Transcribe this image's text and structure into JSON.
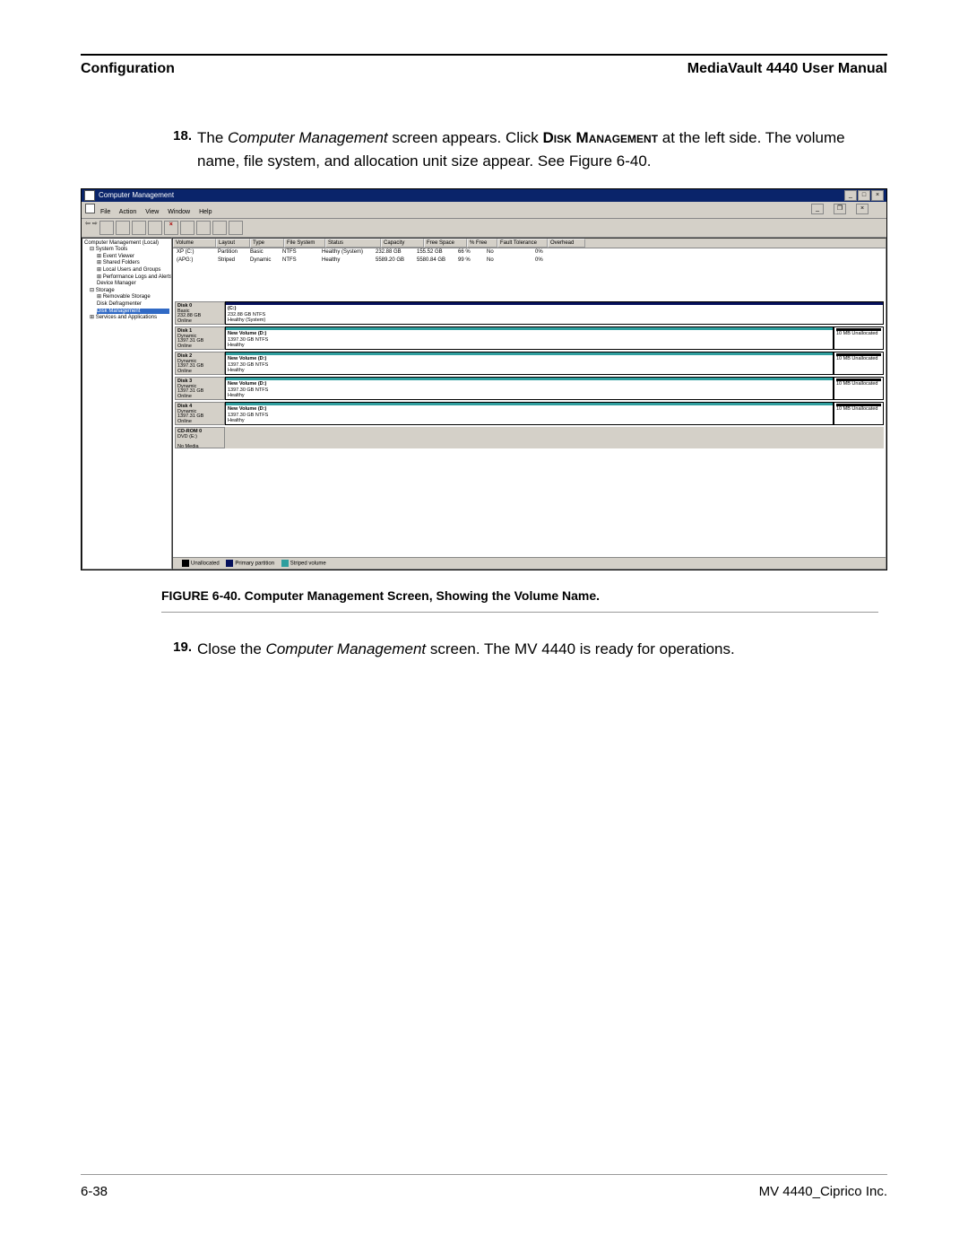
{
  "header": {
    "left": "Configuration",
    "right": "MediaVault 4440 User Manual"
  },
  "step18": {
    "num": "18.",
    "t1": "The ",
    "t2": "Computer Management",
    "t3": " screen appears. Click ",
    "t4": "Disk Management",
    "t5": " at the left side. The volume name, file system, and allocation unit size appear. See Figure 6-40."
  },
  "screenshot": {
    "title": "Computer Management",
    "menus": [
      "File",
      "Action",
      "View",
      "Window",
      "Help"
    ],
    "tree": {
      "root": "Computer Management (Local)",
      "systools": "System Tools",
      "st_items": [
        "Event Viewer",
        "Shared Folders",
        "Local Users and Groups",
        "Performance Logs and Alerts",
        "Device Manager"
      ],
      "storage": "Storage",
      "storage_items": [
        "Removable Storage",
        "Disk Defragmenter",
        "Disk Management"
      ],
      "services": "Services and Applications"
    },
    "vol_headers": [
      "Volume",
      "Layout",
      "Type",
      "File System",
      "Status",
      "Capacity",
      "Free Space",
      "% Free",
      "Fault Tolerance",
      "Overhead"
    ],
    "vol_rows": [
      {
        "v": "XP (C:)",
        "layout": "Partition",
        "type": "Basic",
        "fs": "NTFS",
        "status": "Healthy (System)",
        "cap": "232.88 GB",
        "free": "155.52 GB",
        "pct": "66 %",
        "ft": "No",
        "ov": "0%"
      },
      {
        "v": "(APG:)",
        "layout": "Striped",
        "type": "Dynamic",
        "fs": "NTFS",
        "status": "Healthy",
        "cap": "5589.20 GB",
        "free": "5580.84 GB",
        "pct": "99 %",
        "ft": "No",
        "ov": "0%"
      }
    ],
    "disks": [
      {
        "name": "Disk 0",
        "kind": "Basic",
        "size": "232.88 GB",
        "state": "Online",
        "vol": "(C:)",
        "vdesc": "232.88 GB NTFS",
        "vstat": "Healthy (System)",
        "stripe": "navy",
        "unalloc": ""
      },
      {
        "name": "Disk 1",
        "kind": "Dynamic",
        "size": "1397.31 GB",
        "state": "Online",
        "vol": "New Volume (D:)",
        "vdesc": "1397.30 GB NTFS",
        "vstat": "Healthy",
        "stripe": "teal",
        "unalloc": "10 MB Unallocated"
      },
      {
        "name": "Disk 2",
        "kind": "Dynamic",
        "size": "1397.31 GB",
        "state": "Online",
        "vol": "New Volume (D:)",
        "vdesc": "1397.30 GB NTFS",
        "vstat": "Healthy",
        "stripe": "teal",
        "unalloc": "10 MB Unallocated"
      },
      {
        "name": "Disk 3",
        "kind": "Dynamic",
        "size": "1397.31 GB",
        "state": "Online",
        "vol": "New Volume (D:)",
        "vdesc": "1397.30 GB NTFS",
        "vstat": "Healthy",
        "stripe": "teal",
        "unalloc": "10 MB Unallocated"
      },
      {
        "name": "Disk 4",
        "kind": "Dynamic",
        "size": "1397.31 GB",
        "state": "Online",
        "vol": "New Volume (D:)",
        "vdesc": "1397.30 GB NTFS",
        "vstat": "Healthy",
        "stripe": "teal",
        "unalloc": "10 MB Unallocated"
      }
    ],
    "cdrom": {
      "name": "CD-ROM 0",
      "kind": "DVD (E:)",
      "state": "No Media"
    },
    "legend": {
      "u": "Unallocated",
      "p": "Primary partition",
      "s": "Striped volume"
    }
  },
  "caption": "FIGURE 6-40. Computer Management Screen, Showing the Volume Name.",
  "step19": {
    "num": "19.",
    "t1": "Close the ",
    "t2": "Computer Management",
    "t3": " screen. The MV 4440 is ready for operations."
  },
  "footer": {
    "left": "6-38",
    "right": "MV 4440_Ciprico Inc."
  }
}
